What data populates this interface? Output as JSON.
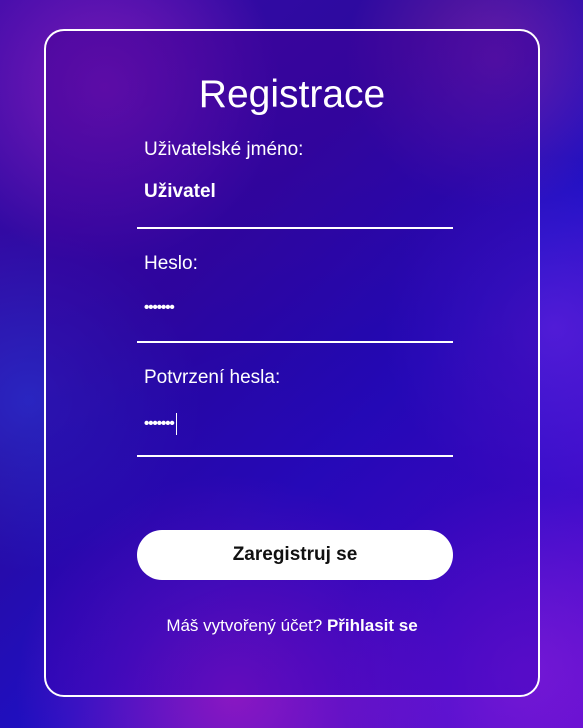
{
  "form": {
    "title": "Registrace",
    "fields": [
      {
        "label": "Uživatelské jméno:",
        "value": "Uživatel"
      },
      {
        "label": "Heslo:",
        "value": "•••••••"
      },
      {
        "label": "Potvrzení hesla:",
        "value": "•••••••"
      }
    ],
    "submit_label": "Zaregistruj se",
    "footer_text": "Máš vytvořený účet?",
    "login_link": "Přihlasit se"
  }
}
